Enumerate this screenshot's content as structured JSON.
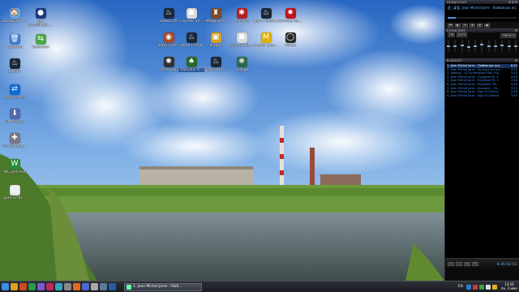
{
  "desktop": {
    "icons": [
      {
        "label": "Домашний...",
        "glyph": "folder-icon",
        "color": "#6aa2e0",
        "symbol": "🏠"
      },
      {
        "label": "gtk-recordMyDesktop",
        "glyph": "record-icon",
        "color": "#1c3a80",
        "symbol": "●"
      },
      {
        "label": "Корзина",
        "glyph": "trash-icon",
        "color": "#3c7fd0",
        "symbol": "🗑"
      },
      {
        "label": "Ееteview",
        "glyph": "teamviewer-icon",
        "color": "#4ea843",
        "symbol": "⇆"
      },
      {
        "label": "Steam",
        "glyph": "steam-icon",
        "color": "#1b2838",
        "symbol": "♨"
      },
      {
        "label": "teamviewer",
        "glyph": "teamviewer-icon",
        "color": "#0e6ad1",
        "symbol": "⇄"
      },
      {
        "label": "DManager",
        "glyph": "download-icon",
        "color": "#5566aa",
        "symbol": "⬇"
      },
      {
        "label": "CrossDesig...",
        "glyph": "crossdesign-icon",
        "color": "#777788",
        "symbol": "✚"
      },
      {
        "label": "WC-pet.exe",
        "glyph": "exe-icon",
        "color": "#2a8a3a",
        "symbol": "W"
      },
      {
        "label": "Для отпр...",
        "glyph": "document-icon",
        "color": "#e8e8e8",
        "symbol": "▤"
      },
      {
        "label": "Robocraft",
        "glyph": "steam-icon",
        "color": "#1b2838",
        "symbol": "♨"
      },
      {
        "label": "Counter-Str...",
        "glyph": "game-icon",
        "color": "#d9d9d9",
        "symbol": "☗"
      },
      {
        "label": "MegaGlest",
        "glyph": "game-icon",
        "color": "#7a4a2a",
        "symbol": "♜"
      },
      {
        "label": "Xonotic",
        "glyph": "game-icon",
        "color": "#b22222",
        "symbol": "✱"
      },
      {
        "label": "Left 4 Dead 2",
        "glyph": "steam-icon",
        "color": "#1b2838",
        "symbol": "♨"
      },
      {
        "label": "Serious Sa...",
        "glyph": "game-icon",
        "color": "#c0151e",
        "symbol": "✸"
      },
      {
        "label": "Team Fortr...",
        "glyph": "game-icon",
        "color": "#a84a2a",
        "symbol": "◉"
      },
      {
        "label": "Dead Island",
        "glyph": "steam-icon",
        "color": "#1b2838",
        "symbol": "♨"
      },
      {
        "label": "Pingus",
        "glyph": "game-icon",
        "color": "#d8a020",
        "symbol": "▣"
      },
      {
        "label": "Counter-Str...",
        "glyph": "game-icon",
        "color": "#d9d9d9",
        "symbol": "☗"
      },
      {
        "label": "Metro: Last...",
        "glyph": "game-icon",
        "color": "#e2b000",
        "symbol": "M"
      },
      {
        "label": "Portal",
        "glyph": "steam-icon",
        "color": "#2a2a2a",
        "symbol": "◯"
      },
      {
        "label": "Tremulous",
        "glyph": "game-icon",
        "color": "#333333",
        "symbol": "✺"
      },
      {
        "label": "Пасьянс А...",
        "glyph": "cards-icon",
        "color": "#2a6a2a",
        "symbol": "♠"
      },
      {
        "label": "Warcraft р...",
        "glyph": "steam-icon",
        "color": "#1b2838",
        "symbol": "♨"
      },
      {
        "label": "Cartige",
        "glyph": "game-icon",
        "color": "#2a6a4a",
        "symbol": "❋"
      }
    ]
  },
  "player": {
    "title": "AUDACIOUS",
    "time": "0:45",
    "marquee": "1. Jean Michel Jarre - Любовные игры",
    "seek_fraction": 0.12,
    "controls": [
      "⏮",
      "▶",
      "⏸",
      "⏹",
      "⏭",
      "⏏"
    ],
    "eq_title": "EQUALIZER",
    "eq_on": "ON",
    "eq_auto": "AUTO",
    "eq_presets": "PRESETS",
    "eq_levels": [
      0.5,
      0.45,
      0.55,
      0.4,
      0.5,
      0.6,
      0.45,
      0.5,
      0.55,
      0.5,
      0.45
    ],
    "playlist_title": "PLAYLIST",
    "tracks": [
      {
        "title": "1. Jean Michel Jarre - Любовные игр...",
        "time": "6:53",
        "current": true
      },
      {
        "title": "2. Jean Michel Jarre - Музыка из тел...",
        "time": "4:50",
        "current": false
      },
      {
        "title": "3. Various - 02 Synthesizer Hits (Fla...",
        "time": "3:45",
        "current": false
      },
      {
        "title": "4. Jean Michel Jarre - Oxygene Pt. 4",
        "time": "4:05",
        "current": false
      },
      {
        "title": "5. Jean Michel Jarre - Equinoxe Pt. 5",
        "time": "3:46",
        "current": false
      },
      {
        "title": "6. Jean Michel Jarre - Magnetic Fie...",
        "time": "4:20",
        "current": false
      },
      {
        "title": "7. Jean Michel Jarre - Souvenir - Ch...",
        "time": "3:51",
        "current": false
      },
      {
        "title": "8. Jean Michel Jarre - Age Of Silence",
        "time": "3:40",
        "current": false
      },
      {
        "title": "9. Jean Michel Jarre - Age Of Silence",
        "time": "3:40",
        "current": false
      }
    ],
    "playlist_time": "0:45/42:53"
  },
  "taskbar": {
    "task_label": "1. Jean Michel Jarre - Люб...",
    "lang": "EN",
    "time": "13:16",
    "date": "пн, 2 июн"
  },
  "colors": {
    "sky_top": "#2f6fc8",
    "sky_bottom": "#a9c9ec",
    "grass": "#6a9a3a",
    "water": "#5a6a62"
  }
}
